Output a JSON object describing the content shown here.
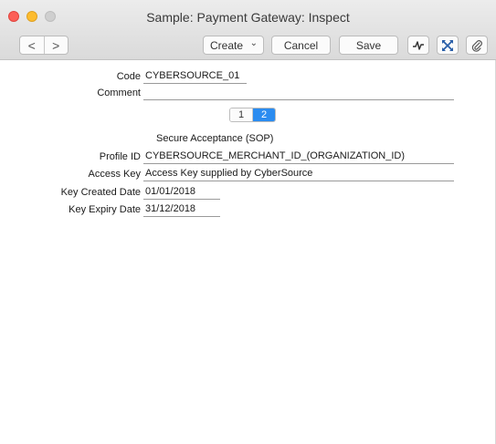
{
  "window": {
    "title": "Sample: Payment Gateway: Inspect"
  },
  "toolbar": {
    "back_glyph": "<",
    "forward_glyph": ">",
    "create_label": "Create",
    "create_chevron": "⌄",
    "cancel_label": "Cancel",
    "save_label": "Save",
    "icons": [
      "activity-icon",
      "expand-icon",
      "paperclip-icon"
    ]
  },
  "form": {
    "code": {
      "label": "Code",
      "value": "CYBERSOURCE_01"
    },
    "comment": {
      "label": "Comment",
      "value": ""
    },
    "pages": [
      "1",
      "2"
    ],
    "active_page": "2",
    "section_title": "Secure Acceptance (SOP)",
    "profile_id": {
      "label": "Profile ID",
      "value": "CYBERSOURCE_MERCHANT_ID_(ORGANIZATION_ID)"
    },
    "access_key": {
      "label": "Access Key",
      "value": "Access Key supplied by CyberSource"
    },
    "key_created_date": {
      "label": "Key Created Date",
      "value": "01/01/2018"
    },
    "key_expiry_date": {
      "label": "Key Expiry Date",
      "value": "31/12/2018"
    }
  },
  "colors": {
    "accent": "#2b8cf0",
    "close": "#fc5f57",
    "minimize": "#fdbc2e",
    "zoom": "#cfcfcf"
  }
}
